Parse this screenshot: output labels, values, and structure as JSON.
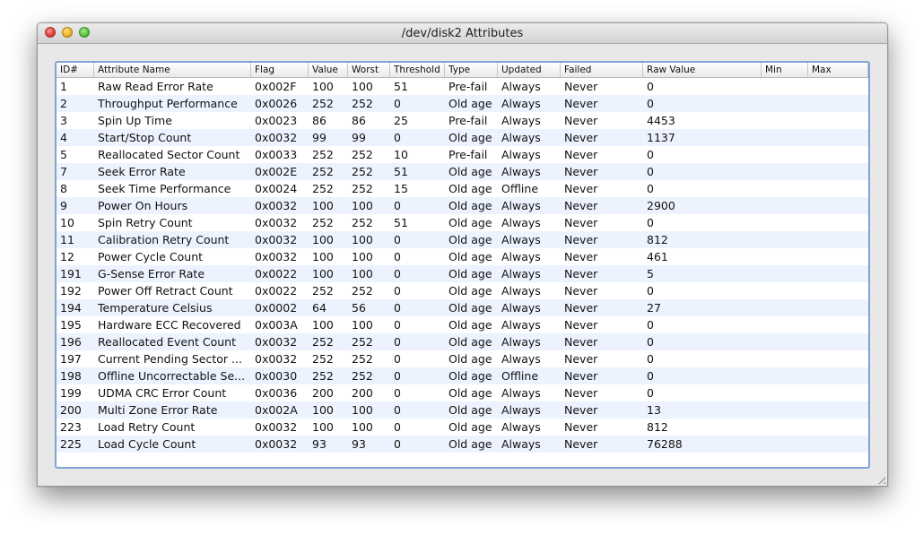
{
  "window": {
    "title": "/dev/disk2 Attributes"
  },
  "table": {
    "columns": [
      "ID#",
      "Attribute Name",
      "Flag",
      "Value",
      "Worst",
      "Threshold",
      "Type",
      "Updated",
      "Failed",
      "Raw Value",
      "Min",
      "Max"
    ],
    "rows": [
      [
        "1",
        "Raw Read Error Rate",
        "0x002F",
        "100",
        "100",
        "51",
        "Pre-fail",
        "Always",
        "Never",
        "0",
        "",
        ""
      ],
      [
        "2",
        "Throughput Performance",
        "0x0026",
        "252",
        "252",
        "0",
        "Old age",
        "Always",
        "Never",
        "0",
        "",
        ""
      ],
      [
        "3",
        "Spin Up Time",
        "0x0023",
        "86",
        "86",
        "25",
        "Pre-fail",
        "Always",
        "Never",
        "4453",
        "",
        ""
      ],
      [
        "4",
        "Start/Stop Count",
        "0x0032",
        "99",
        "99",
        "0",
        "Old age",
        "Always",
        "Never",
        "1137",
        "",
        ""
      ],
      [
        "5",
        "Reallocated Sector Count",
        "0x0033",
        "252",
        "252",
        "10",
        "Pre-fail",
        "Always",
        "Never",
        "0",
        "",
        ""
      ],
      [
        "7",
        "Seek Error Rate",
        "0x002E",
        "252",
        "252",
        "51",
        "Old age",
        "Always",
        "Never",
        "0",
        "",
        ""
      ],
      [
        "8",
        "Seek Time Performance",
        "0x0024",
        "252",
        "252",
        "15",
        "Old age",
        "Offline",
        "Never",
        "0",
        "",
        ""
      ],
      [
        "9",
        "Power On Hours",
        "0x0032",
        "100",
        "100",
        "0",
        "Old age",
        "Always",
        "Never",
        "2900",
        "",
        ""
      ],
      [
        "10",
        "Spin Retry Count",
        "0x0032",
        "252",
        "252",
        "51",
        "Old age",
        "Always",
        "Never",
        "0",
        "",
        ""
      ],
      [
        "11",
        "Calibration Retry Count",
        "0x0032",
        "100",
        "100",
        "0",
        "Old age",
        "Always",
        "Never",
        "812",
        "",
        ""
      ],
      [
        "12",
        "Power Cycle Count",
        "0x0032",
        "100",
        "100",
        "0",
        "Old age",
        "Always",
        "Never",
        "461",
        "",
        ""
      ],
      [
        "191",
        "G-Sense Error Rate",
        "0x0022",
        "100",
        "100",
        "0",
        "Old age",
        "Always",
        "Never",
        "5",
        "",
        ""
      ],
      [
        "192",
        "Power Off Retract Count",
        "0x0022",
        "252",
        "252",
        "0",
        "Old age",
        "Always",
        "Never",
        "0",
        "",
        ""
      ],
      [
        "194",
        "Temperature Celsius",
        "0x0002",
        "64",
        "56",
        "0",
        "Old age",
        "Always",
        "Never",
        "27",
        "",
        ""
      ],
      [
        "195",
        "Hardware ECC Recovered",
        "0x003A",
        "100",
        "100",
        "0",
        "Old age",
        "Always",
        "Never",
        "0",
        "",
        ""
      ],
      [
        "196",
        "Reallocated Event Count",
        "0x0032",
        "252",
        "252",
        "0",
        "Old age",
        "Always",
        "Never",
        "0",
        "",
        ""
      ],
      [
        "197",
        "Current Pending Sector ...",
        "0x0032",
        "252",
        "252",
        "0",
        "Old age",
        "Always",
        "Never",
        "0",
        "",
        ""
      ],
      [
        "198",
        "Offline Uncorrectable Se...",
        "0x0030",
        "252",
        "252",
        "0",
        "Old age",
        "Offline",
        "Never",
        "0",
        "",
        ""
      ],
      [
        "199",
        "UDMA CRC Error Count",
        "0x0036",
        "200",
        "200",
        "0",
        "Old age",
        "Always",
        "Never",
        "0",
        "",
        ""
      ],
      [
        "200",
        "Multi Zone Error Rate",
        "0x002A",
        "100",
        "100",
        "0",
        "Old age",
        "Always",
        "Never",
        "13",
        "",
        ""
      ],
      [
        "223",
        "Load Retry Count",
        "0x0032",
        "100",
        "100",
        "0",
        "Old age",
        "Always",
        "Never",
        "812",
        "",
        ""
      ],
      [
        "225",
        "Load Cycle Count",
        "0x0032",
        "93",
        "93",
        "0",
        "Old age",
        "Always",
        "Never",
        "76288",
        "",
        ""
      ]
    ]
  },
  "colors": {
    "row_alt": "#edf3fe",
    "focus_border": "#7fa4d3"
  }
}
